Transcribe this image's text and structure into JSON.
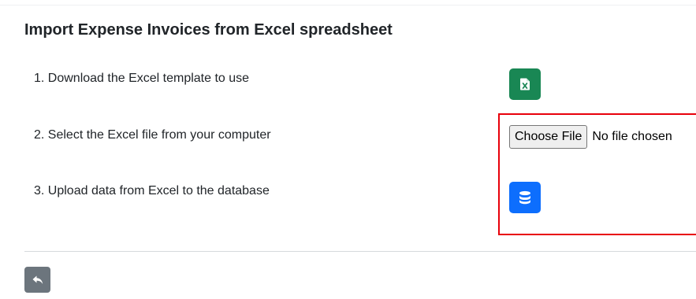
{
  "title": "Import Expense Invoices from Excel spreadsheet",
  "steps": [
    {
      "label": "1. Download the Excel template to use",
      "icon": "file-excel-icon"
    },
    {
      "label": "2. Select the Excel file from your computer",
      "icon": ""
    },
    {
      "label": "3. Upload data from Excel to the database",
      "icon": "database-icon"
    }
  ],
  "file_input": {
    "button_label": "Choose File",
    "status": "No file chosen"
  },
  "back_button": {
    "icon": "reply-arrow-icon"
  },
  "colors": {
    "excel_button": "#198754",
    "upload_button": "#0d6efd",
    "back_button": "#6c757d",
    "highlight_border": "#e8000b"
  }
}
